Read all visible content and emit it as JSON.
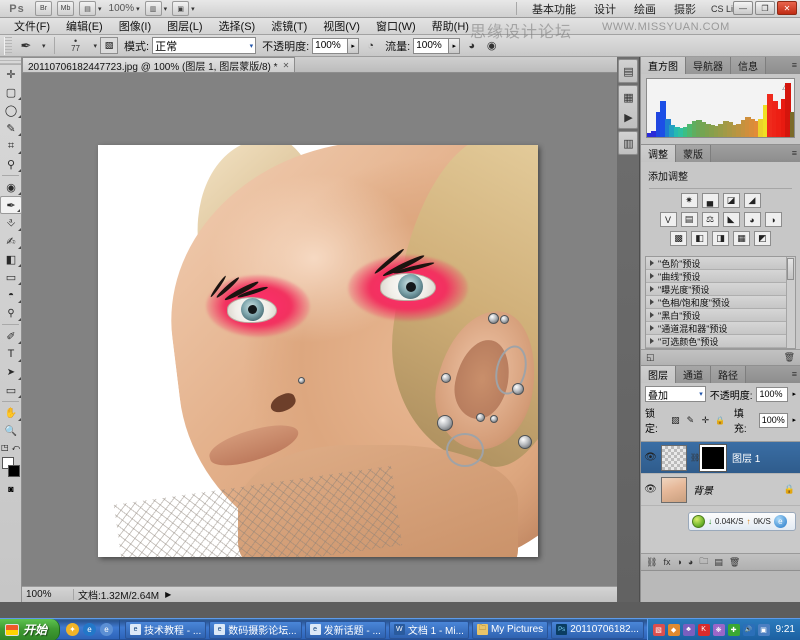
{
  "app": {
    "name": "Adobe Photoshop CS4",
    "logo_text": "Ps",
    "zoom_level": "100%",
    "cs_live_label": "CS Live",
    "titlebar_buttons": [
      {
        "name": "bridge-button",
        "glyph": "Br"
      },
      {
        "name": "mini-bridge-button",
        "glyph": "Mb"
      },
      {
        "name": "view-extras-button",
        "glyph": "▤"
      },
      {
        "name": "arrange-documents-button",
        "glyph": "▥"
      },
      {
        "name": "screen-mode-button",
        "glyph": "▣"
      }
    ],
    "workspace_tabs": [
      {
        "label": "基本功能"
      },
      {
        "label": "设计"
      },
      {
        "label": "绘画"
      },
      {
        "label": "摄影"
      }
    ],
    "window_buttons": [
      {
        "name": "minimize-button",
        "glyph": "—"
      },
      {
        "name": "restore-button",
        "glyph": "❐"
      },
      {
        "name": "close-button",
        "glyph": "✕"
      }
    ]
  },
  "watermark": {
    "chinese": "思缘设计论坛",
    "english": "WWW.MISSYUAN.COM"
  },
  "menubar": {
    "items": [
      {
        "label": "文件(F)"
      },
      {
        "label": "编辑(E)"
      },
      {
        "label": "图像(I)"
      },
      {
        "label": "图层(L)"
      },
      {
        "label": "选择(S)"
      },
      {
        "label": "滤镜(T)"
      },
      {
        "label": "视图(V)"
      },
      {
        "label": "窗口(W)"
      },
      {
        "label": "帮助(H)"
      }
    ]
  },
  "options_bar": {
    "tool_icon": "brush-tool",
    "brush_size": "77",
    "mode_label": "模式:",
    "mode_value": "正常",
    "opacity_label": "不透明度:",
    "opacity_value": "100%",
    "flow_label": "流量:",
    "flow_value": "100%",
    "airbrush_icon": "airbrush-icon",
    "tablet_pressure_opacity_icon": "pressure-opacity-icon",
    "tablet_pressure_size_icon": "pressure-size-icon"
  },
  "toolbox": {
    "tools": [
      {
        "name": "move-tool",
        "glyph": "✛",
        "selected": false,
        "has_flyout": false
      },
      {
        "name": "rectangular-marquee-tool",
        "glyph": "▢",
        "selected": false,
        "has_flyout": true
      },
      {
        "name": "lasso-tool",
        "glyph": "◯",
        "selected": false,
        "has_flyout": true
      },
      {
        "name": "quick-selection-tool",
        "glyph": "✎",
        "selected": false,
        "has_flyout": true
      },
      {
        "name": "crop-tool",
        "glyph": "⌗",
        "selected": false,
        "has_flyout": true
      },
      {
        "name": "eyedropper-tool",
        "glyph": "⚲",
        "selected": false,
        "has_flyout": true
      },
      {
        "name": "spot-healing-brush-tool",
        "glyph": "◉",
        "selected": false,
        "has_flyout": true
      },
      {
        "name": "brush-tool",
        "glyph": "✒",
        "selected": true,
        "has_flyout": true
      },
      {
        "name": "clone-stamp-tool",
        "glyph": "⎀",
        "selected": false,
        "has_flyout": true
      },
      {
        "name": "history-brush-tool",
        "glyph": "✍",
        "selected": false,
        "has_flyout": true
      },
      {
        "name": "eraser-tool",
        "glyph": "◧",
        "selected": false,
        "has_flyout": true
      },
      {
        "name": "gradient-tool",
        "glyph": "▭",
        "selected": false,
        "has_flyout": true
      },
      {
        "name": "blur-tool",
        "glyph": "💧",
        "selected": false,
        "has_flyout": true
      },
      {
        "name": "dodge-tool",
        "glyph": "⚭",
        "selected": false,
        "has_flyout": true
      },
      {
        "name": "pen-tool",
        "glyph": "✐",
        "selected": false,
        "has_flyout": true
      },
      {
        "name": "horizontal-type-tool",
        "glyph": "T",
        "selected": false,
        "has_flyout": true
      },
      {
        "name": "path-selection-tool",
        "glyph": "➤",
        "selected": false,
        "has_flyout": true
      },
      {
        "name": "rectangle-tool",
        "glyph": "▭",
        "selected": false,
        "has_flyout": true
      },
      {
        "name": "hand-tool",
        "glyph": "✋",
        "selected": false,
        "has_flyout": true
      },
      {
        "name": "zoom-tool",
        "glyph": "🔍",
        "selected": false,
        "has_flyout": false
      }
    ],
    "foreground_color": "#ffffff",
    "background_color": "#000000",
    "swap_colors_icon": "swap-colors-icon",
    "default_colors_icon": "default-colors-icon",
    "quick_mask_icon": "quick-mask-icon"
  },
  "document": {
    "tab_title": "20110706182447723.jpg @ 100% (图层 1, 图层蒙版/8) *",
    "close_glyph": "✕",
    "status_zoom": "100%",
    "status_info": "文档:1.32M/2.64M",
    "status_arrow": "▶"
  },
  "panel_rail": {
    "icons": [
      {
        "name": "history-panel-icon",
        "glyph": "▤"
      },
      {
        "name": "swatches-panel-icon",
        "glyph": "▦"
      },
      {
        "name": "actions-panel-icon",
        "glyph": "▶"
      },
      {
        "name": "character-panel-icon",
        "glyph": "▥"
      }
    ]
  },
  "histogram_panel": {
    "tabs": [
      {
        "label": "直方图",
        "active": true
      },
      {
        "label": "导航器",
        "active": false
      },
      {
        "label": "信息",
        "active": false
      }
    ],
    "menu_glyph": "≡",
    "warning_glyph": "⚠"
  },
  "adjustments_panel": {
    "tabs": [
      {
        "label": "调整",
        "active": true
      },
      {
        "label": "蒙版",
        "active": false
      }
    ],
    "menu_glyph": "≡",
    "title": "添加调整",
    "row1": [
      {
        "name": "brightness-contrast-icon",
        "glyph": "✷"
      },
      {
        "name": "levels-icon",
        "glyph": "▄"
      },
      {
        "name": "curves-icon",
        "glyph": "◪"
      },
      {
        "name": "exposure-icon",
        "glyph": "◢"
      }
    ],
    "row2": [
      {
        "name": "vibrance-icon",
        "glyph": "V"
      },
      {
        "name": "hue-saturation-icon",
        "glyph": "▤"
      },
      {
        "name": "color-balance-icon",
        "glyph": "⚖"
      },
      {
        "name": "black-white-icon",
        "glyph": "◣"
      },
      {
        "name": "photo-filter-icon",
        "glyph": "◕"
      },
      {
        "name": "channel-mixer-icon",
        "glyph": "◑"
      }
    ],
    "row3": [
      {
        "name": "invert-icon",
        "glyph": "▩"
      },
      {
        "name": "posterize-icon",
        "glyph": "◧"
      },
      {
        "name": "threshold-icon",
        "glyph": "◨"
      },
      {
        "name": "gradient-map-icon",
        "glyph": "▦"
      },
      {
        "name": "selective-color-icon",
        "glyph": "◩"
      }
    ],
    "presets": [
      {
        "label": "\"色阶\"预设"
      },
      {
        "label": "\"曲线\"预设"
      },
      {
        "label": "\"曝光度\"预设"
      },
      {
        "label": "\"色相/饱和度\"预设"
      },
      {
        "label": "\"黑白\"预设"
      },
      {
        "label": "\"通道混和器\"预设"
      },
      {
        "label": "\"可选颜色\"预设"
      }
    ],
    "foot_left_icon": "return-to-adjustment-list-icon",
    "foot_left_glyph": "◱",
    "foot_right_icon": "delete-adjustment-layer-icon",
    "foot_right_glyph": "🗑"
  },
  "layers_panel": {
    "tabs": [
      {
        "label": "图层",
        "active": true
      },
      {
        "label": "通道",
        "active": false
      },
      {
        "label": "路径",
        "active": false
      }
    ],
    "menu_glyph": "≡",
    "blend_mode": "叠加",
    "blend_arrow": "▾",
    "opacity_label": "不透明度:",
    "opacity_value": "100%",
    "lock_label": "锁定:",
    "lock_icons": [
      {
        "name": "lock-transparent-pixels-icon",
        "glyph": "▨"
      },
      {
        "name": "lock-image-pixels-icon",
        "glyph": "✎"
      },
      {
        "name": "lock-position-icon",
        "glyph": "✛"
      },
      {
        "name": "lock-all-icon",
        "glyph": "🔒"
      }
    ],
    "fill_label": "填充:",
    "fill_value": "100%",
    "layers": [
      {
        "name": "图层 1",
        "visible_icon": "eye-icon",
        "eye_glyph": "👁",
        "thumb_type": "checker",
        "has_mask": true,
        "link_glyph": "⛓",
        "selected": true,
        "locked": false
      },
      {
        "name": "背景",
        "visible_icon": "eye-icon",
        "eye_glyph": "👁",
        "thumb_type": "face",
        "has_mask": false,
        "link_glyph": "",
        "selected": false,
        "locked": true,
        "lock_glyph": "🔒"
      }
    ],
    "footer_icons": [
      {
        "name": "link-layers-icon",
        "glyph": "⛓"
      },
      {
        "name": "layer-style-icon",
        "glyph": "fx"
      },
      {
        "name": "add-layer-mask-icon",
        "glyph": "◑"
      },
      {
        "name": "new-adjustment-layer-icon",
        "glyph": "◕"
      },
      {
        "name": "new-group-icon",
        "glyph": "🗀"
      },
      {
        "name": "new-layer-icon",
        "glyph": "▤"
      },
      {
        "name": "delete-layer-icon",
        "glyph": "🗑"
      }
    ]
  },
  "net_speed_widget": {
    "down_arrow": "↓",
    "down_value": "0.04K/S",
    "up_arrow": "↑",
    "up_value": "0K/S",
    "browser_icon": "internet-explorer-icon",
    "browser_glyph": "e"
  },
  "taskbar": {
    "start_label": "开始",
    "quick_launch": [
      {
        "name": "media-player-icon",
        "glyph": "✦",
        "color": "#f0b429"
      },
      {
        "name": "internet-explorer-icon",
        "glyph": "e",
        "color": "#2277c8"
      },
      {
        "name": "browser-icon",
        "glyph": "e",
        "color": "#5b8fd4"
      }
    ],
    "tasks": [
      {
        "label": "技术教程 - ...",
        "icon": "ie-window-icon"
      },
      {
        "label": "数码摄影论坛...",
        "icon": "ie-window-icon"
      },
      {
        "label": "发新话题 - ...",
        "icon": "ie-window-icon"
      },
      {
        "label": "文档 1 - Mi...",
        "icon": "word-window-icon"
      },
      {
        "label": "My Pictures",
        "icon": "folder-window-icon"
      },
      {
        "label": "20110706182...",
        "icon": "photoshop-window-icon"
      }
    ],
    "tray_icons": [
      {
        "name": "tray-app-icon-1",
        "glyph": "▧",
        "color": "#d94f4f"
      },
      {
        "name": "tray-app-icon-2",
        "glyph": "◆",
        "color": "#e08a2e"
      },
      {
        "name": "tray-app-icon-3",
        "glyph": "♣",
        "color": "#7a5fbf"
      },
      {
        "name": "tray-kingsoft-icon",
        "glyph": "K",
        "color": "#d92b2b"
      },
      {
        "name": "tray-app-icon-4",
        "glyph": "❋",
        "color": "#9a66c8"
      },
      {
        "name": "tray-app-icon-5",
        "glyph": "✚",
        "color": "#3aa832"
      },
      {
        "name": "tray-volume-icon",
        "glyph": "🔊",
        "color": "#2b6fb8"
      },
      {
        "name": "tray-network-icon",
        "glyph": "▣",
        "color": "#4b7fc2"
      }
    ],
    "clock": "9:21"
  },
  "artwork": {
    "description": "portrait photograph of a woman with pink eye makeup, long false eyelashes and multiple ear piercings",
    "background_color": "#ffffff"
  },
  "chart_data": {
    "type": "bar",
    "title": "直方图",
    "xlabel": "",
    "ylabel": "",
    "categories": [
      "0",
      "8",
      "16",
      "24",
      "32",
      "40",
      "48",
      "56",
      "64",
      "72",
      "80",
      "88",
      "96",
      "104",
      "112",
      "120",
      "128",
      "136",
      "144",
      "152",
      "160",
      "168",
      "176",
      "184",
      "192",
      "200",
      "208",
      "216",
      "224",
      "232",
      "240",
      "248",
      "255"
    ],
    "values": [
      6,
      10,
      40,
      58,
      30,
      20,
      17,
      15,
      16,
      22,
      26,
      28,
      25,
      21,
      19,
      18,
      22,
      26,
      24,
      20,
      22,
      28,
      32,
      30,
      26,
      30,
      52,
      70,
      58,
      46,
      62,
      88,
      40
    ],
    "colors": [
      "#2b2bd8",
      "#2b2bd8",
      "#1f46e0",
      "#1c4fe6",
      "#1f7fd0",
      "#22a0c0",
      "#26b9b0",
      "#2fc0a0",
      "#3bbf84",
      "#4fb86e",
      "#5fae60",
      "#6aa858",
      "#74a552",
      "#7da24e",
      "#86a04c",
      "#8f9e4a",
      "#989c48",
      "#a19a46",
      "#aa9844",
      "#b39642",
      "#bc9440",
      "#c5923e",
      "#cf8f3c",
      "#d88d3a",
      "#e28b38",
      "#ebd22a",
      "#f0e024",
      "#ef2a1c",
      "#ee2418",
      "#ed1f14",
      "#e81a10",
      "#d4150c",
      "#7a6b2a"
    ],
    "ylim": [
      0,
      100
    ],
    "grid": false,
    "legend": "none"
  }
}
